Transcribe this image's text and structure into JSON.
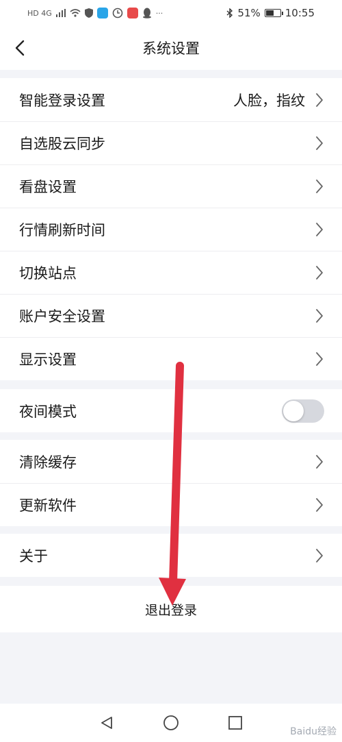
{
  "status_bar": {
    "network": "HD 4G",
    "battery_text": "51%",
    "battery_level": 0.51,
    "time": "10:55"
  },
  "header": {
    "title": "系统设置"
  },
  "groups": [
    {
      "items": [
        {
          "label": "智能登录设置",
          "value": "人脸，指纹"
        },
        {
          "label": "自选股云同步"
        },
        {
          "label": "看盘设置"
        },
        {
          "label": "行情刷新时间"
        },
        {
          "label": "切换站点"
        },
        {
          "label": "账户安全设置"
        },
        {
          "label": "显示设置"
        }
      ]
    },
    {
      "items": [
        {
          "label": "夜间模式",
          "toggle_on": false
        }
      ]
    },
    {
      "items": [
        {
          "label": "清除缓存"
        },
        {
          "label": "更新软件"
        }
      ]
    },
    {
      "items": [
        {
          "label": "关于"
        }
      ]
    }
  ],
  "logout_label": "退出登录",
  "watermark": "Baidu经验",
  "colors": {
    "background": "#f3f4f8",
    "annotation_arrow": "#e03040",
    "toggle_off": "#d6d8de"
  }
}
